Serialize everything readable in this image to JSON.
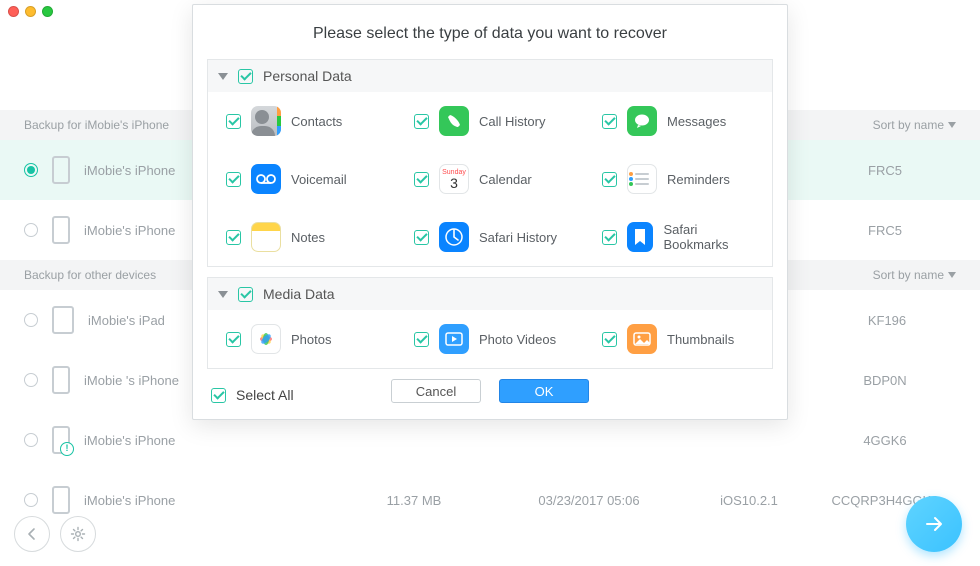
{
  "window": {
    "traffic": [
      "close",
      "minimize",
      "zoom"
    ]
  },
  "modal": {
    "title": "Please select the type of data you want to recover",
    "categories": [
      {
        "name": "Personal Data",
        "key": "personal",
        "items": [
          {
            "id": "contacts",
            "label": "Contacts"
          },
          {
            "id": "call-history",
            "label": "Call History"
          },
          {
            "id": "messages",
            "label": "Messages"
          },
          {
            "id": "voicemail",
            "label": "Voicemail"
          },
          {
            "id": "calendar",
            "label": "Calendar",
            "cal_month": "Sunday",
            "cal_day": "3"
          },
          {
            "id": "reminders",
            "label": "Reminders"
          },
          {
            "id": "notes",
            "label": "Notes"
          },
          {
            "id": "safari-history",
            "label": "Safari History"
          },
          {
            "id": "safari-bookmarks",
            "label": "Safari Bookmarks"
          }
        ]
      },
      {
        "name": "Media Data",
        "key": "media",
        "items": [
          {
            "id": "photos",
            "label": "Photos"
          },
          {
            "id": "photo-videos",
            "label": "Photo Videos"
          },
          {
            "id": "thumbnails",
            "label": "Thumbnails"
          }
        ]
      }
    ],
    "select_all": "Select All",
    "cancel": "Cancel",
    "ok": "OK"
  },
  "bg": {
    "sections": [
      {
        "title": "Backup for iMobie's iPhone",
        "sort": "Sort by name",
        "rows": [
          {
            "sel": true,
            "name": "iMobie's iPhone",
            "size": "",
            "date": "",
            "os": "",
            "serial": "FRC5"
          },
          {
            "sel": false,
            "name": "iMobie's iPhone",
            "size": "",
            "date": "",
            "os": "",
            "serial": "FRC5"
          }
        ]
      },
      {
        "title": "Backup for other devices",
        "sort": "Sort by name",
        "rows": [
          {
            "sel": false,
            "name": "iMobie's iPad",
            "wide": true,
            "size": "",
            "date": "",
            "os": "",
            "serial": "KF196"
          },
          {
            "sel": false,
            "name": "iMobie 's iPhone",
            "size": "",
            "date": "",
            "os": "",
            "serial": "BDP0N"
          },
          {
            "sel": false,
            "name": "iMobie's iPhone",
            "badge": true,
            "size": "",
            "date": "",
            "os": "",
            "serial": "4GGK6"
          },
          {
            "sel": false,
            "name": "iMobie's iPhone",
            "size": "11.37 MB",
            "date": "03/23/2017 05:06",
            "os": "iOS10.2.1",
            "serial": "CCQRP3H4GGK6"
          }
        ]
      }
    ]
  }
}
